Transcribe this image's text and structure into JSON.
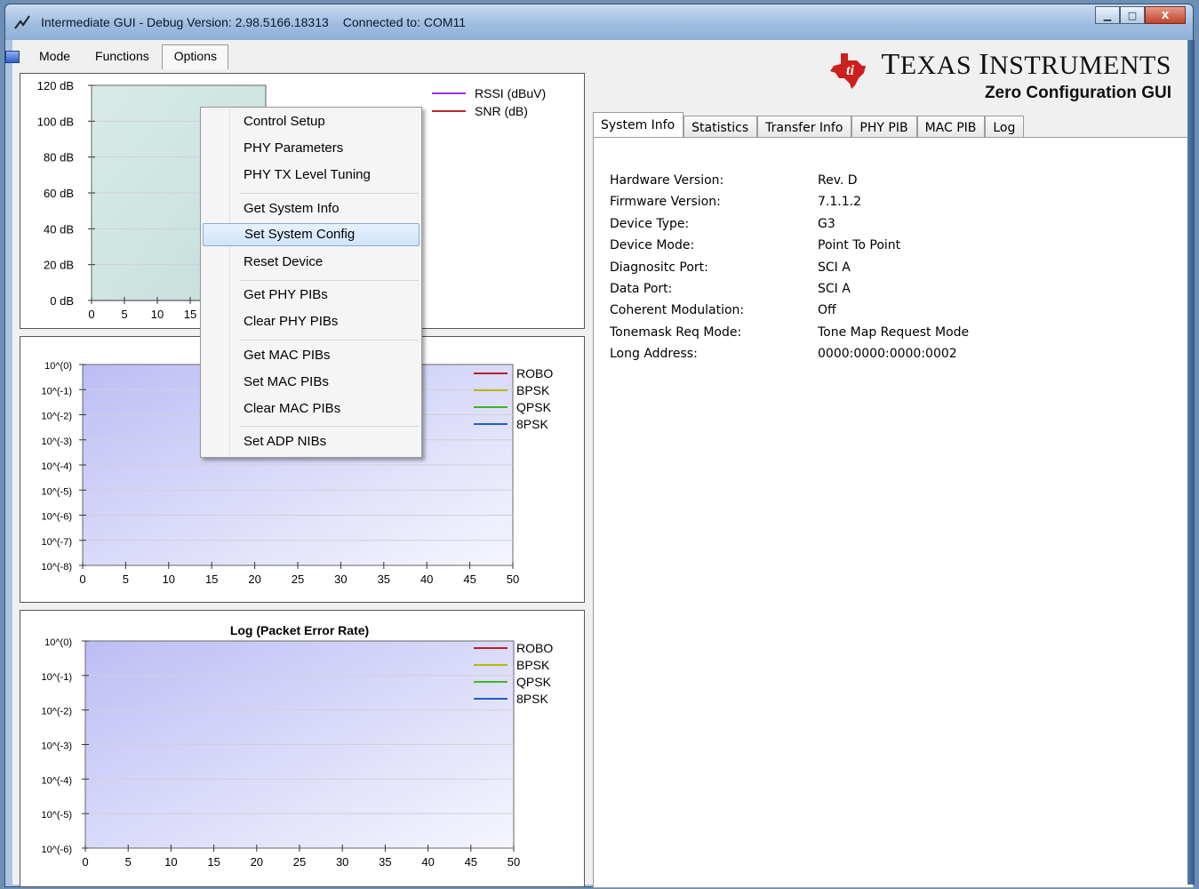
{
  "window": {
    "title": "Intermediate GUI - Debug Version: 2.98.5166.18313",
    "connection": "Connected to: COM11",
    "buttons": {
      "minimize": "▁",
      "maximize": "□",
      "close": "X"
    }
  },
  "menubar": {
    "items": [
      "Mode",
      "Functions",
      "Options"
    ],
    "open_menu": "Options"
  },
  "options_menu": {
    "items": [
      "Control Setup",
      "PHY Parameters",
      "PHY TX Level Tuning",
      "Get System Info",
      "Set System Config",
      "Reset Device",
      "Get PHY PIBs",
      "Clear PHY PIBs",
      "Get MAC PIBs",
      "Set MAC PIBs",
      "Clear MAC PIBs",
      "Set ADP NIBs"
    ],
    "selected": "Set System Config"
  },
  "logo": {
    "brand_t": "T",
    "brand_exas": "EXAS ",
    "brand_i": "I",
    "brand_nstruments": "NSTRUMENTS",
    "subtitle": "Zero Configuration GUI"
  },
  "tabs": [
    "System Info",
    "Statistics",
    "Transfer Info",
    "PHY PIB",
    "MAC PIB",
    "Log"
  ],
  "active_tab": "System Info",
  "system_info": {
    "hardware_version": {
      "label": "Hardware Version:",
      "value": "Rev. D"
    },
    "firmware_version": {
      "label": "Firmware Version:",
      "value": "7.1.1.2"
    },
    "device_type": {
      "label": "Device Type:",
      "value": "G3"
    },
    "device_mode": {
      "label": "Device Mode:",
      "value": "Point To Point"
    },
    "diagnostic_port": {
      "label": "Diagnositc Port:",
      "value": "SCI A"
    },
    "data_port": {
      "label": "Data Port:",
      "value": "SCI A"
    },
    "coherent_modulation": {
      "label": "Coherent Modulation:",
      "value": "Off"
    },
    "tonemask_req_mode": {
      "label": "Tonemask Req Mode:",
      "value": "Tone Map Request Mode"
    },
    "long_address": {
      "label": "Long Address:",
      "value": "0000:0000:0000:0002"
    }
  },
  "chart_data": [
    {
      "type": "line",
      "title": "",
      "ylabel": "",
      "xlabel": "",
      "y_ticks": [
        "120 dB",
        "100 dB",
        "80 dB",
        "60 dB",
        "40 dB",
        "20 dB",
        "0 dB"
      ],
      "x_ticks": [
        "0",
        "5",
        "10",
        "15"
      ],
      "ylim": [
        0,
        120
      ],
      "series": [
        {
          "name": "RSSI (dBuV)",
          "color": "#9b30d9",
          "values": []
        },
        {
          "name": "SNR (dB)",
          "color": "#c0282d",
          "values": []
        }
      ]
    },
    {
      "type": "line",
      "title": "",
      "y_ticks": [
        "10^(0)",
        "10^(-1)",
        "10^(-2)",
        "10^(-3)",
        "10^(-4)",
        "10^(-5)",
        "10^(-6)",
        "10^(-7)",
        "10^(-8)"
      ],
      "x_ticks": [
        "0",
        "5",
        "10",
        "15",
        "20",
        "25",
        "30",
        "35",
        "40",
        "45",
        "50"
      ],
      "xlim": [
        0,
        50
      ],
      "yscale": "log",
      "series": [
        {
          "name": "ROBO",
          "color": "#b22222",
          "values": []
        },
        {
          "name": "BPSK",
          "color": "#b8b800",
          "values": []
        },
        {
          "name": "QPSK",
          "color": "#3cb81f",
          "values": []
        },
        {
          "name": "8PSK",
          "color": "#1f5fc8",
          "values": []
        }
      ]
    },
    {
      "type": "line",
      "title": "Log (Packet Error Rate)",
      "y_ticks": [
        "10^(0)",
        "10^(-1)",
        "10^(-2)",
        "10^(-3)",
        "10^(-4)",
        "10^(-5)",
        "10^(-6)"
      ],
      "x_ticks": [
        "0",
        "5",
        "10",
        "15",
        "20",
        "25",
        "30",
        "35",
        "40",
        "45",
        "50"
      ],
      "xlim": [
        0,
        50
      ],
      "yscale": "log",
      "series": [
        {
          "name": "ROBO",
          "color": "#b22222",
          "values": []
        },
        {
          "name": "BPSK",
          "color": "#b8b800",
          "values": []
        },
        {
          "name": "QPSK",
          "color": "#3cb81f",
          "values": []
        },
        {
          "name": "8PSK",
          "color": "#1f5fc8",
          "values": []
        }
      ]
    }
  ]
}
